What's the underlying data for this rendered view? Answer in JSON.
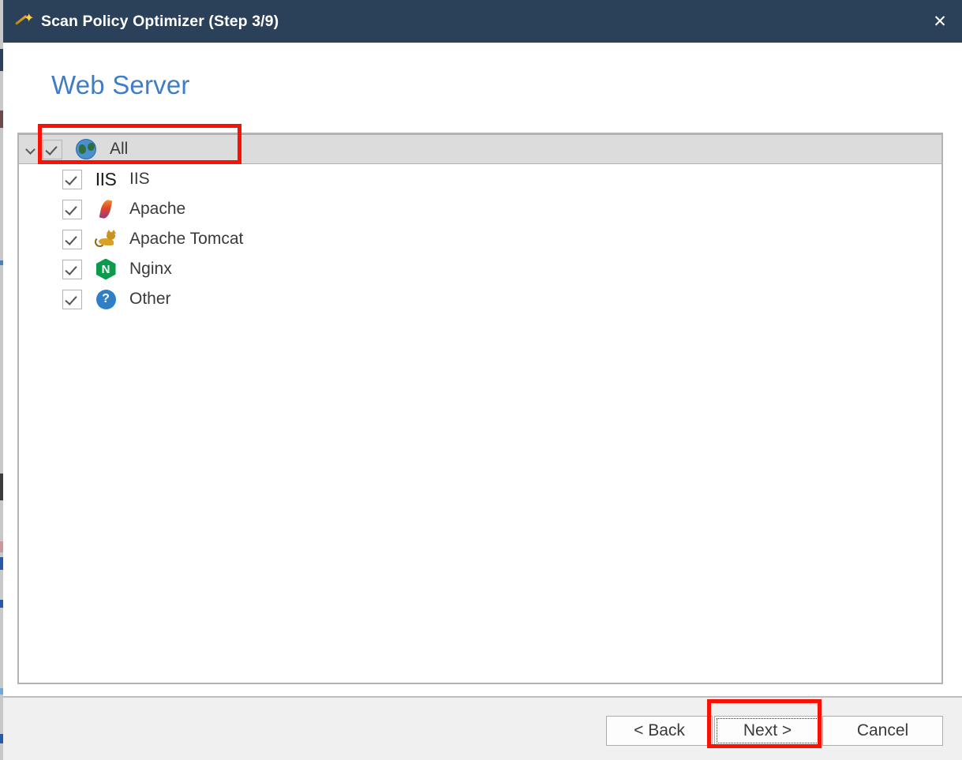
{
  "window": {
    "title": "Scan Policy Optimizer (Step 3/9)",
    "titlebar_icon": "magic-wand-icon",
    "close_label": "✕",
    "titlebar_color": "#2b4159"
  },
  "page": {
    "heading": "Web Server",
    "heading_color": "#3f7dc4"
  },
  "tree": {
    "expander_glyph": "chevron-down-icon",
    "check_glyph": "✓",
    "items": [
      {
        "label": "All",
        "icon": "globe-icon",
        "checked": true,
        "selected": true,
        "indent": 0,
        "highlighted": true
      },
      {
        "label": "IIS",
        "icon": "iis-icon",
        "checked": true,
        "selected": false,
        "indent": 1,
        "highlighted": false
      },
      {
        "label": "Apache",
        "icon": "apache-feather-icon",
        "checked": true,
        "selected": false,
        "indent": 1,
        "highlighted": false
      },
      {
        "label": "Apache Tomcat",
        "icon": "tomcat-cat-icon",
        "checked": true,
        "selected": false,
        "indent": 1,
        "highlighted": false
      },
      {
        "label": "Nginx",
        "icon": "nginx-icon",
        "checked": true,
        "selected": false,
        "indent": 1,
        "highlighted": false
      },
      {
        "label": "Other",
        "icon": "question-mark-icon",
        "checked": true,
        "selected": false,
        "indent": 1,
        "highlighted": false
      }
    ],
    "icon_glyphs": {
      "iis": "IIS",
      "nginx": "N",
      "question": "?"
    }
  },
  "footer": {
    "back_label": "< Back",
    "next_label": "Next >",
    "cancel_label": "Cancel",
    "focused_button": "Next >"
  },
  "annotations": {
    "color": "#fb1005",
    "boxes": [
      "all-row",
      "next-button"
    ]
  }
}
